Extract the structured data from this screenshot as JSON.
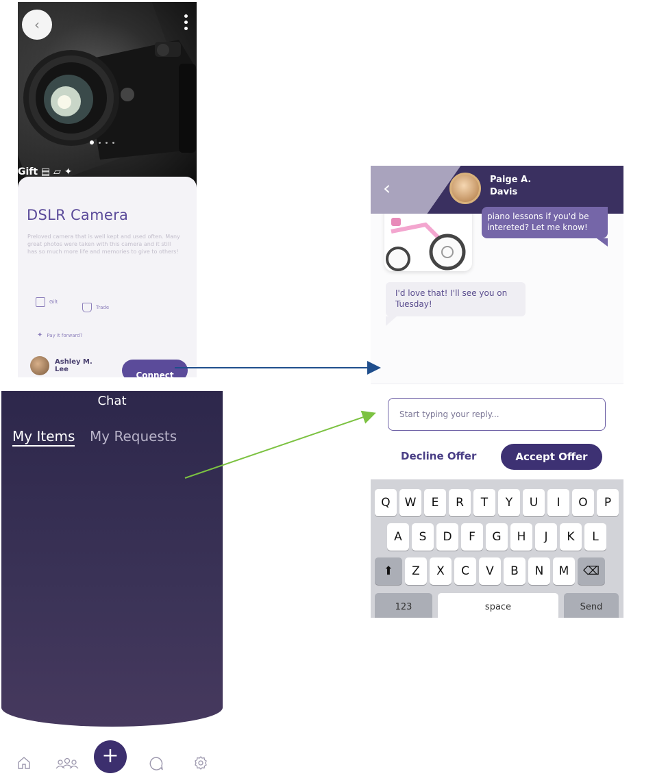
{
  "item_screen": {
    "gift_strip": "Gift",
    "item": {
      "title": "DSLR Camera",
      "description": "Preloved camera that is well kept and used often. Many great photos were taken with this camera and it still has so much more life and memories to give to others!",
      "options": [
        "Gift",
        "Trade",
        "Pay it forward?"
      ],
      "owner_name": "Ashley M. Lee",
      "connect_label": "Connect"
    }
  },
  "chat_list": {
    "title": "Chat",
    "tabs": [
      {
        "label": "My Items",
        "active": true
      },
      {
        "label": "My Requests",
        "active": false
      }
    ],
    "nav": {
      "icons": [
        "home-icon",
        "people-icon",
        "plus-icon",
        "chat-bubble-icon",
        "settings-icon"
      ]
    }
  },
  "conversation": {
    "contact_name": "Paige A. Davis",
    "messages": [
      {
        "from": "contact",
        "text": "piano lessons if you'd be intereted? Let me know!"
      },
      {
        "from": "me",
        "text": "I'd love that! I'll see you on Tuesday!"
      }
    ],
    "reply_placeholder": "Start typing your reply...",
    "decline_label": "Decline Offer",
    "accept_label": "Accept Offer",
    "keyboard": {
      "row1": [
        "Q",
        "W",
        "E",
        "R",
        "T",
        "Y",
        "U",
        "I",
        "O",
        "P"
      ],
      "row2": [
        "A",
        "S",
        "D",
        "F",
        "G",
        "H",
        "J",
        "K",
        "L"
      ],
      "row3": [
        "Z",
        "X",
        "C",
        "V",
        "B",
        "N",
        "M"
      ],
      "numbers_key": "123",
      "space_key": "space",
      "send_key": "Send"
    }
  },
  "colors": {
    "brand_purple": "#5b4b9a",
    "dark_purple": "#3d3173",
    "arrow_blue": "#1f4e8c",
    "arrow_green": "#7cc242"
  }
}
